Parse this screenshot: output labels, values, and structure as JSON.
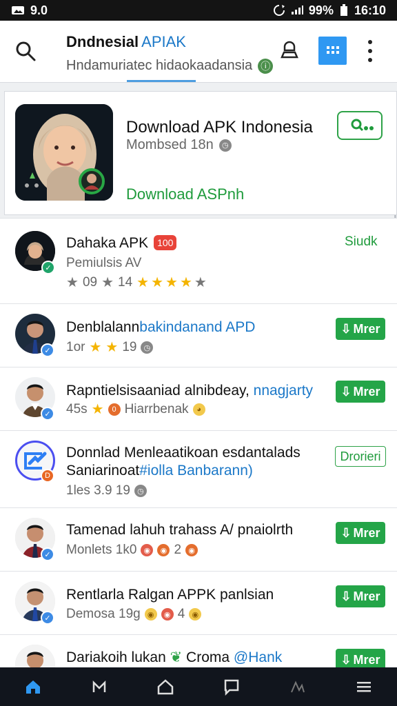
{
  "status": {
    "left_text": "9.0",
    "right_text": "99%",
    "time": "16:10"
  },
  "app_bar": {
    "title": "Dndnesial",
    "brand": "APIAK",
    "subtitle": "Hndamuriatec hidaokaadansia",
    "subtitle_badge": "ⓘ"
  },
  "featured": {
    "title": "Download APK Indonesia",
    "meta": "Mombsed 18n",
    "action": "Download ASPnh",
    "button_icon": "install-icon"
  },
  "items": [
    {
      "title": "Dahaka APK",
      "badge": "100",
      "subtitle": "Pemiulsis AV",
      "rating_text": "09",
      "rating_text2": "14",
      "link": "Siudk"
    },
    {
      "title": "Denblalann",
      "title_link": "bakindanand APD",
      "subtitle": "1or",
      "subtitle_num": "19",
      "button": "Mrer"
    },
    {
      "title": "Rapntielsisaaniad alnibdeay,",
      "title_link": "nnagjarty",
      "subtitle": "45s",
      "subtitle_link": "Hiarrbenak",
      "button": "Mrer"
    },
    {
      "title": "Donnlad Menleaatikoan esdantalads",
      "title_second": "Saniarinoat",
      "title_second_link": "#iolla Banbarann)",
      "subtitle": "1les 3.9 19",
      "button": "Drorieri"
    },
    {
      "title": "Tamenad lahuh trahass A/ pnaiolrth",
      "subtitle": "Monlets 1k0",
      "subtitle_count": "2",
      "button": "Mrer"
    },
    {
      "title": "Rentlarla Ralgan APPK panlsian",
      "subtitle": "Demosa 19g",
      "subtitle_count": "4",
      "button": "Mrer"
    },
    {
      "title": "Dariakoih lukan",
      "title_mid": "Croma",
      "title_link": "@Hank",
      "button": "Mrer"
    }
  ],
  "nav": {
    "home": "home-icon",
    "back": "back-icon",
    "house": "house-icon",
    "chat": "chat-icon",
    "activity": "activity-icon",
    "menu": "menu-icon"
  }
}
